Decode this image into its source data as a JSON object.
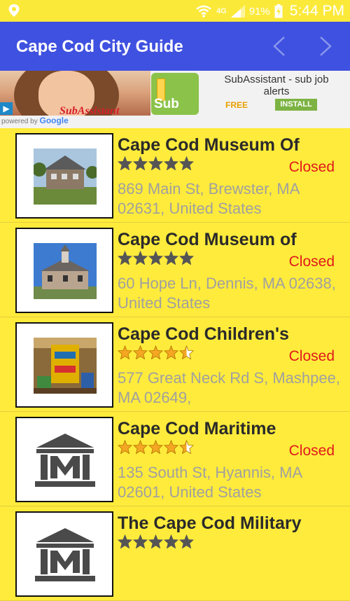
{
  "status_bar": {
    "signal_label": "4G",
    "battery_percent": "91%",
    "time": "5:44 PM"
  },
  "app_bar": {
    "title": "Cape Cod City Guide"
  },
  "ad": {
    "overlay_text": "SubAssistant",
    "icon_text": "Sub",
    "app_name": "SubAssistant - sub job alerts",
    "free_label": "FREE",
    "install_label": "INSTALL",
    "powered_by": "powered by",
    "google": "Google"
  },
  "places": [
    {
      "name": "Cape Cod Museum Of",
      "rating": 0,
      "status": "Closed",
      "address": "869 Main St, Brewster, MA 02631, United States",
      "thumb": "photo-house"
    },
    {
      "name": "Cape Cod Museum of",
      "rating": 0,
      "status": "Closed",
      "address": "60 Hope Ln, Dennis, MA 02638, United States",
      "thumb": "photo-building"
    },
    {
      "name": "Cape Cod Children's",
      "rating": 4.5,
      "status": "Closed",
      "address": "577 Great Neck Rd S, Mashpee, MA 02649,",
      "thumb": "photo-playground"
    },
    {
      "name": "Cape Cod Maritime",
      "rating": 4.5,
      "status": "Closed",
      "address": "135 South St, Hyannis, MA 02601, United States",
      "thumb": "museum-icon"
    },
    {
      "name": "The Cape Cod Military",
      "rating": 0,
      "status": "",
      "address": "",
      "thumb": "museum-icon"
    }
  ],
  "colors": {
    "background": "#ffeb3b",
    "app_bar": "#3f51e0",
    "closed": "#e0191b",
    "star_filled": "#f5a623",
    "star_empty": "#555555"
  }
}
